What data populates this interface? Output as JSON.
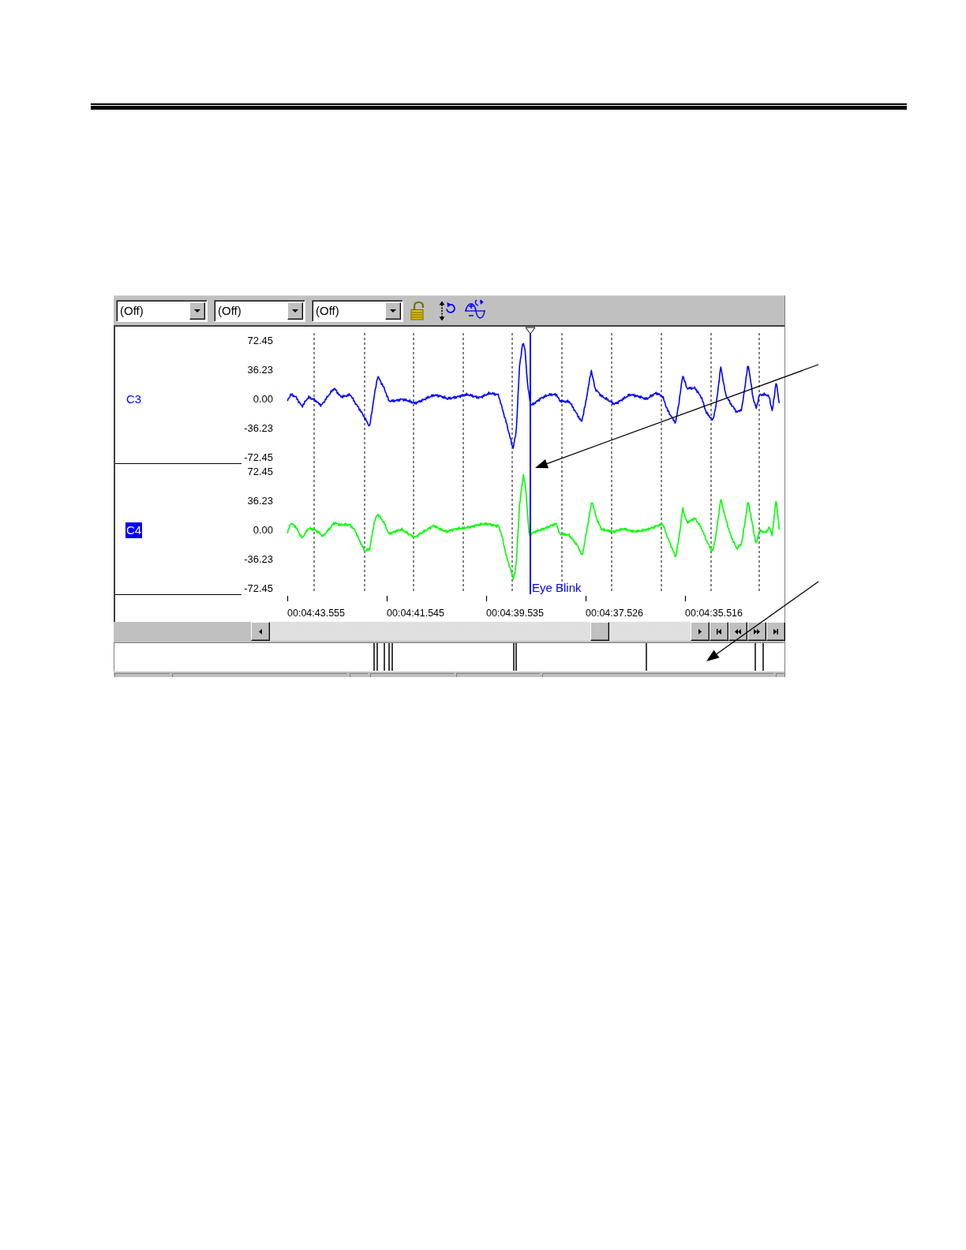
{
  "toolbar": {
    "dropdowns": [
      {
        "value": "(Off)"
      },
      {
        "value": "(Off)"
      },
      {
        "value": "(Off)"
      }
    ]
  },
  "channels": [
    {
      "name": "C3",
      "selected": false,
      "color": "#0000ff",
      "scale_labels": [
        "72.45",
        "36.23",
        "0.00",
        "-36.23",
        "-72.45"
      ]
    },
    {
      "name": "C4",
      "selected": true,
      "color": "#00ff00",
      "scale_labels": [
        "72.45",
        "36.23",
        "0.00",
        "-36.23",
        "-72.45"
      ]
    }
  ],
  "cursor": {
    "label": "Eye Blink"
  },
  "time_axis": {
    "labels": [
      "00:04:43.555",
      "00:04:41.545",
      "00:04:39.535",
      "00:04:37.526",
      "00:04:35.516"
    ]
  }
}
